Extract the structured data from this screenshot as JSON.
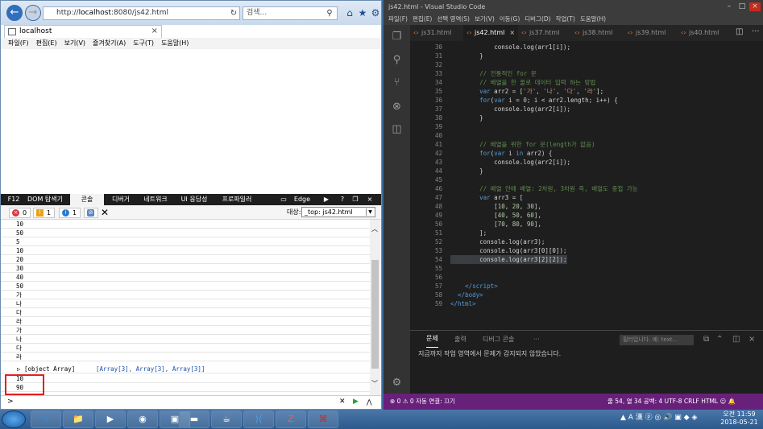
{
  "ie": {
    "url_prefix": "http://",
    "url_domain": "localhost",
    "url_rest": ":8080/js42.html",
    "search_placeholder": "검색...",
    "tab_title": "localhost",
    "menu": [
      "파일(F)",
      "편집(E)",
      "보기(V)",
      "즐겨찾기(A)",
      "도구(T)",
      "도움말(H)"
    ],
    "devtools_tabs": [
      "F12",
      "DOM 탐색기",
      "콘솔",
      "디버거",
      "네트워크",
      "UI 응답성",
      "프로파일러",
      "Edge"
    ],
    "errors": "0",
    "warnings": "1",
    "infos": "1",
    "target_label": "대상:",
    "target_value": "_top: js42.html",
    "console_lines": [
      "10",
      "50",
      "5",
      "10",
      "20",
      "30",
      "40",
      "50",
      "가",
      "나",
      "다",
      "라",
      "가",
      "나",
      "다",
      "라"
    ],
    "array_obj": "▷ [object Array]",
    "array_val": "[Array[3], Array[3], Array[3]]",
    "tail_lines": [
      "10",
      "90"
    ],
    "prompt": ">"
  },
  "vscode": {
    "title": "js42.html - Visual Studio Code",
    "menu": [
      "파일(F)",
      "편집(E)",
      "선택 영역(S)",
      "보기(V)",
      "이동(G)",
      "디버그(D)",
      "작업(T)",
      "도움말(H)"
    ],
    "tabs": [
      "js31.html",
      "js42.html",
      "js37.html",
      "js38.html",
      "js39.html",
      "js40.html"
    ],
    "line_numbers": [
      "30",
      "31",
      "32",
      "33",
      "34",
      "35",
      "36",
      "37",
      "38",
      "39",
      "40",
      "41",
      "42",
      "43",
      "44",
      "45",
      "46",
      "47",
      "48",
      "49",
      "50",
      "51",
      "52",
      "53",
      "54",
      "55",
      "56",
      "57",
      "58",
      "59"
    ],
    "panel_tabs": [
      "문제",
      "출력",
      "디버그 콘솔",
      "···"
    ],
    "panel_filter": "필터입니다. 예: text...",
    "panel_message": "지금까지 작업 영역에서 문제가 감지되지 않았습니다.",
    "status_left": "⊗ 0  ⚠ 0    자동 연결: 끄기",
    "status_right": "줄 54, 열 34   공백: 4   UTF-8   CRLF   HTML   ☺  🔔"
  },
  "taskbar": {
    "tray": "▲ A 漢 ⓟ ◎ 🔊 ▣ ◆ ◈",
    "time": "오전 11:59",
    "date": "2018-05-21"
  },
  "colors": {
    "vs_status": "#68217a",
    "keyword": "#569cd6",
    "comment": "#608b4e",
    "string": "#ce9178",
    "highlight_box": "#e02020"
  }
}
